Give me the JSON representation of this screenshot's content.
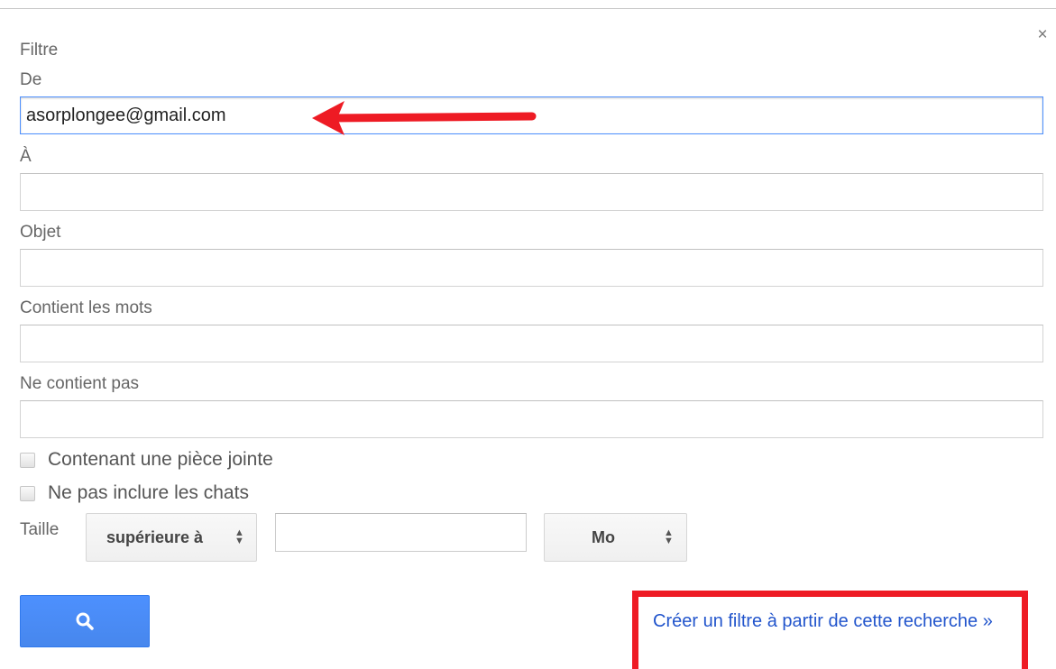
{
  "dialog": {
    "title": "Filtre",
    "close_symbol": "×"
  },
  "fields": {
    "from": {
      "label": "De",
      "value": "asorplongee@gmail.com",
      "placeholder": ""
    },
    "to": {
      "label": "À",
      "value": "",
      "placeholder": ""
    },
    "subject": {
      "label": "Objet",
      "value": "",
      "placeholder": ""
    },
    "has_words": {
      "label": "Contient les mots",
      "value": "",
      "placeholder": ""
    },
    "doesnt_have": {
      "label": "Ne contient pas",
      "value": "",
      "placeholder": ""
    }
  },
  "checkboxes": {
    "has_attachment": {
      "label": "Contenant une pièce jointe",
      "checked": false
    },
    "exclude_chats": {
      "label": "Ne pas inclure les chats",
      "checked": false
    }
  },
  "size": {
    "label": "Taille",
    "comparator": "supérieure à",
    "value": "",
    "unit": "Mo",
    "arrows": "▲▼"
  },
  "actions": {
    "search_icon": "search-icon",
    "create_filter_link": "Créer un filtre à partir de cette recherche »"
  },
  "annotations": {
    "arrow_color": "#ee1b24",
    "box_color": "#ee1b24"
  },
  "colors": {
    "search_button": "#4d90fe",
    "link": "#2255cc",
    "focus_border": "#4d90fe"
  }
}
